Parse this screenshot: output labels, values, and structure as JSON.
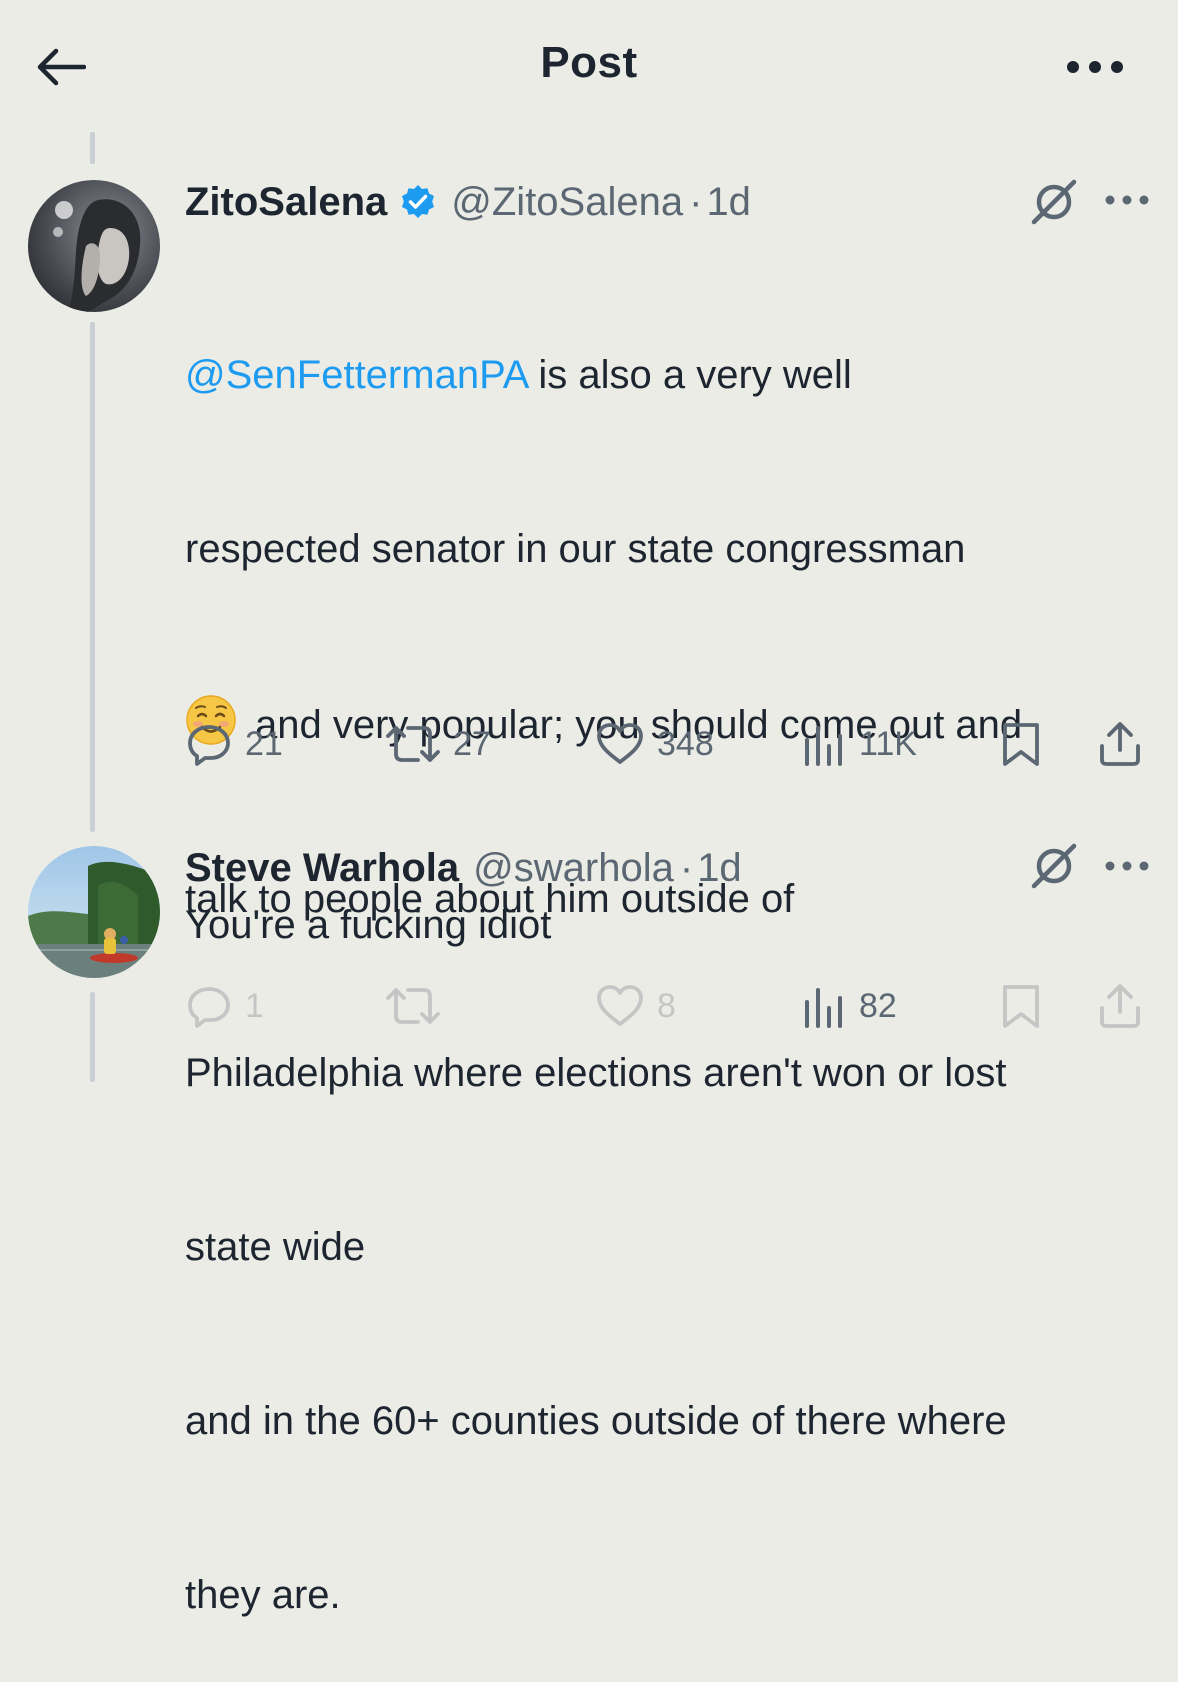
{
  "header": {
    "title": "Post"
  },
  "tweets": [
    {
      "display_name": "ZitoSalena",
      "verified": true,
      "handle": "@ZitoSalena",
      "separator": "·",
      "time": "1d",
      "mention": "@SenFettermanPA",
      "text_line1_rest": " is also a very well",
      "text_line2": "respected senator in our state congressman",
      "emoji": "smiling-face-emoji",
      "text_line3_rest": "and very popular; you should come out and",
      "text_line4": "talk to people about him outside of",
      "text_line5": "Philadelphia where elections aren't won or lost",
      "text_line6": "state wide",
      "text_line7": "and in the 60+ counties outside of there where",
      "text_line8": "they are.",
      "replies": "21",
      "reposts": "27",
      "likes": "348",
      "views": "11K"
    },
    {
      "display_name": "Steve Warhola",
      "verified": false,
      "handle": "@swarhola",
      "separator": "·",
      "time": "1d",
      "text": "You're a fucking idiot",
      "replies": "1",
      "reposts": "",
      "likes": "8",
      "views": "82"
    }
  ],
  "colors": {
    "background": "#ecece6",
    "text": "#1d2530",
    "muted": "#5b6772",
    "link": "#1d9bf0",
    "thread_line": "#c9cfd4"
  }
}
